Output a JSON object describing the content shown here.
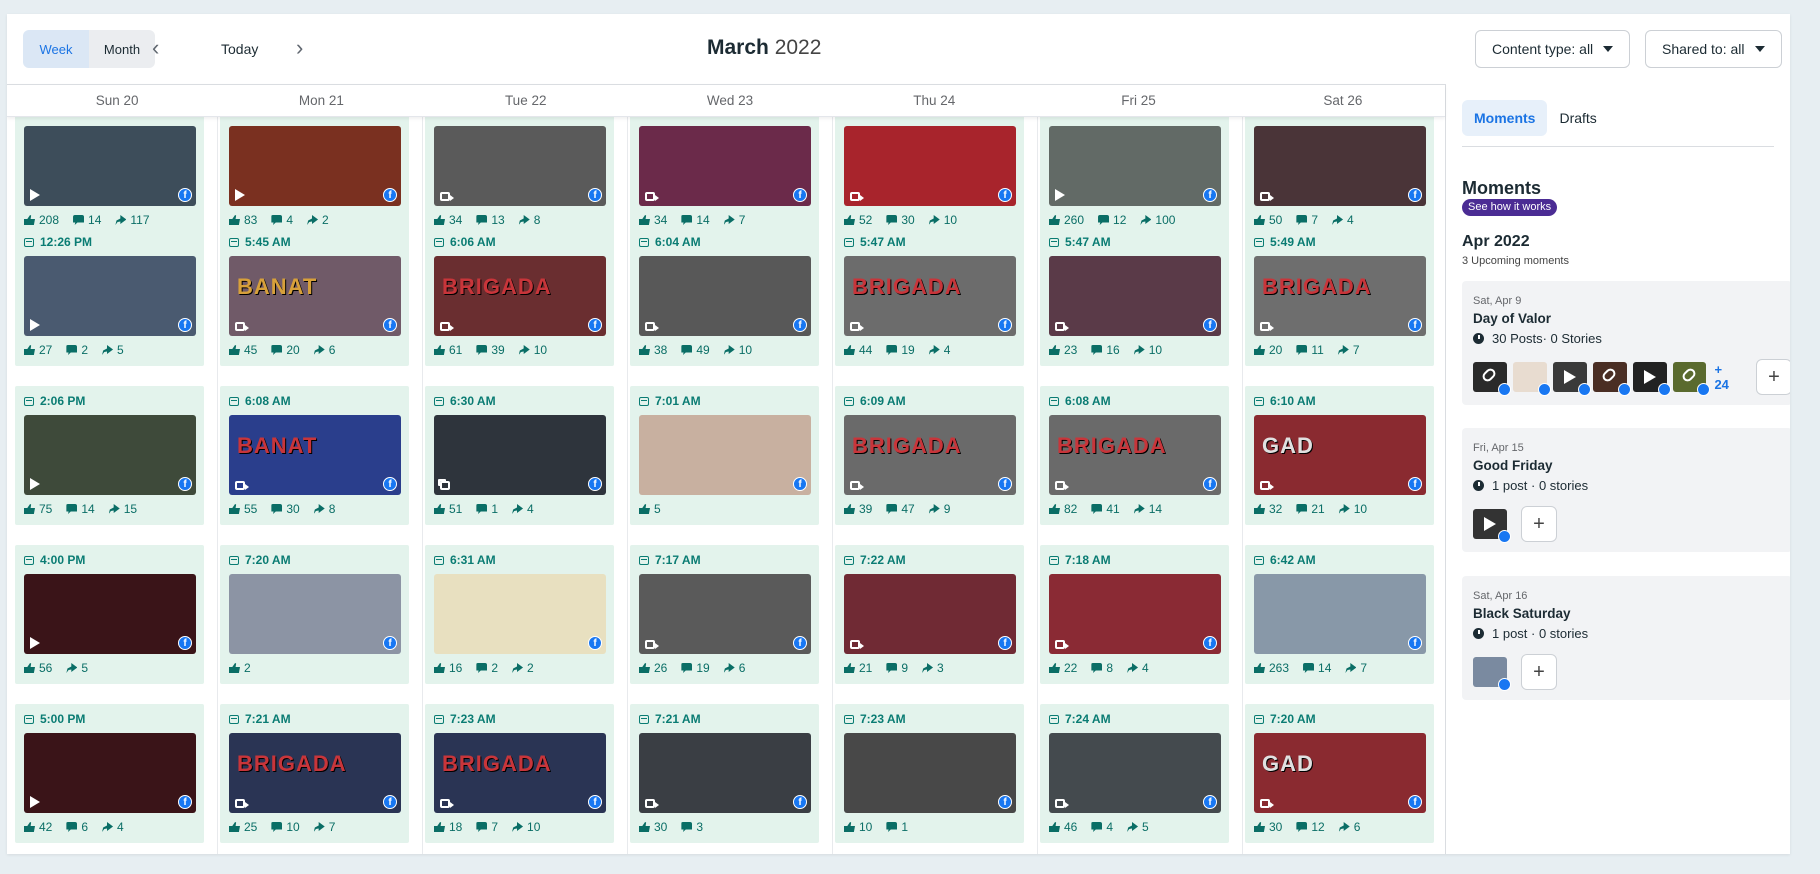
{
  "toolbar": {
    "week_label": "Week",
    "month_label": "Month",
    "today_label": "Today",
    "prev_icon": "‹",
    "next_icon": "›",
    "title_month": "March",
    "title_year": "2022",
    "content_type": "Content type: all",
    "shared_to": "Shared to: all"
  },
  "days": [
    "Sun 20",
    "Mon 21",
    "Tue 22",
    "Wed 23",
    "Thu 24",
    "Fri 25",
    "Sat 26"
  ],
  "rows": [
    [
      {
        "time": "",
        "type": "play",
        "bg": "#3d4d5a",
        "stats": {
          "likes": "208",
          "comments": "14",
          "shares": "117"
        }
      },
      {
        "time": "",
        "type": "play",
        "bg": "#7a3020",
        "stats": {
          "likes": "83",
          "comments": "4",
          "shares": "2"
        }
      },
      {
        "time": "",
        "type": "cam",
        "bg": "#5a5a5a",
        "stats": {
          "likes": "34",
          "comments": "13",
          "shares": "8"
        }
      },
      {
        "time": "",
        "type": "cam",
        "bg": "#6b2a4a",
        "stats": {
          "likes": "34",
          "comments": "14",
          "shares": "7"
        }
      },
      {
        "time": "",
        "type": "cam",
        "bg": "#a8242c",
        "stats": {
          "likes": "52",
          "comments": "30",
          "shares": "10"
        }
      },
      {
        "time": "",
        "type": "play",
        "bg": "#626a66",
        "stats": {
          "likes": "260",
          "comments": "12",
          "shares": "100"
        }
      },
      {
        "time": "",
        "type": "cam",
        "bg": "#4a3438",
        "stats": {
          "likes": "50",
          "comments": "7",
          "shares": "4"
        }
      }
    ],
    [
      {
        "time": "12:26 PM",
        "type": "play",
        "bg": "#4a5a70",
        "title": "",
        "tcolor": "#fff",
        "stats": {
          "likes": "27",
          "comments": "2",
          "shares": "5"
        }
      },
      {
        "time": "5:45 AM",
        "type": "cam",
        "bg": "#705a68",
        "title": "BANAT",
        "tcolor": "#d7a03a",
        "stats": {
          "likes": "45",
          "comments": "20",
          "shares": "6"
        }
      },
      {
        "time": "6:06 AM",
        "type": "cam",
        "bg": "#6a2e30",
        "title": "BRIGADA",
        "tcolor": "#c8353a",
        "stats": {
          "likes": "61",
          "comments": "39",
          "shares": "10"
        }
      },
      {
        "time": "6:04 AM",
        "type": "cam",
        "bg": "#585858",
        "title": "",
        "tcolor": "#c22",
        "stats": {
          "likes": "38",
          "comments": "49",
          "shares": "10"
        }
      },
      {
        "time": "5:47 AM",
        "type": "cam",
        "bg": "#6c6c6c",
        "title": "BRIGADA",
        "tcolor": "#c8353a",
        "stats": {
          "likes": "44",
          "comments": "19",
          "shares": "4"
        }
      },
      {
        "time": "5:47 AM",
        "type": "cam",
        "bg": "#5a3a48",
        "title": "",
        "tcolor": "#fff",
        "stats": {
          "likes": "23",
          "comments": "16",
          "shares": "10"
        }
      },
      {
        "time": "5:49 AM",
        "type": "cam",
        "bg": "#6e6e6e",
        "title": "BRIGADA",
        "tcolor": "#c8353a",
        "stats": {
          "likes": "20",
          "comments": "11",
          "shares": "7"
        }
      }
    ],
    [
      {
        "time": "2:06 PM",
        "type": "play",
        "bg": "#3e4a3a",
        "title": "",
        "tcolor": "#fff",
        "stats": {
          "likes": "75",
          "comments": "14",
          "shares": "15"
        }
      },
      {
        "time": "6:08 AM",
        "type": "cam",
        "bg": "#2a3e8c",
        "title": "BANAT",
        "tcolor": "#c8353a",
        "stats": {
          "likes": "55",
          "comments": "30",
          "shares": "8"
        }
      },
      {
        "time": "6:30 AM",
        "type": "album",
        "bg": "#2e343c",
        "title": "",
        "tcolor": "#fff",
        "stats": {
          "likes": "51",
          "comments": "1",
          "shares": "4"
        }
      },
      {
        "time": "7:01 AM",
        "type": "none",
        "bg": "#c8b0a0",
        "title": "",
        "tcolor": "#fff",
        "stats": {
          "likes": "5",
          "comments": "",
          "shares": ""
        }
      },
      {
        "time": "6:09 AM",
        "type": "cam",
        "bg": "#6a6a6a",
        "title": "BRIGADA",
        "tcolor": "#c8353a",
        "stats": {
          "likes": "39",
          "comments": "47",
          "shares": "9"
        }
      },
      {
        "time": "6:08 AM",
        "type": "cam",
        "bg": "#6a6a6a",
        "title": "BRIGADA",
        "tcolor": "#c8353a",
        "stats": {
          "likes": "82",
          "comments": "41",
          "shares": "14"
        }
      },
      {
        "time": "6:10 AM",
        "type": "cam",
        "bg": "#8a2a30",
        "title": "GAD",
        "tcolor": "#e0e0e0",
        "stats": {
          "likes": "32",
          "comments": "21",
          "shares": "10"
        }
      }
    ],
    [
      {
        "time": "4:00 PM",
        "type": "play",
        "bg": "#3a1418",
        "title": "",
        "tcolor": "#fff",
        "stats": {
          "likes": "56",
          "comments": "",
          "shares": "5"
        }
      },
      {
        "time": "7:20 AM",
        "type": "none",
        "bg": "#8c94a4",
        "title": "",
        "tcolor": "#fff",
        "stats": {
          "likes": "2",
          "comments": "",
          "shares": ""
        }
      },
      {
        "time": "6:31 AM",
        "type": "none",
        "bg": "#e8e0c0",
        "title": "",
        "tcolor": "#333",
        "stats": {
          "likes": "16",
          "comments": "2",
          "shares": "2"
        }
      },
      {
        "time": "7:17 AM",
        "type": "cam",
        "bg": "#5a5a5a",
        "title": "",
        "tcolor": "#c22",
        "stats": {
          "likes": "26",
          "comments": "19",
          "shares": "6"
        }
      },
      {
        "time": "7:22 AM",
        "type": "cam",
        "bg": "#702a34",
        "title": "",
        "tcolor": "#fff",
        "stats": {
          "likes": "21",
          "comments": "9",
          "shares": "3"
        }
      },
      {
        "time": "7:18 AM",
        "type": "cam",
        "bg": "#8a2a34",
        "title": "",
        "tcolor": "#fff",
        "stats": {
          "likes": "22",
          "comments": "8",
          "shares": "4"
        }
      },
      {
        "time": "6:42 AM",
        "type": "none",
        "bg": "#8898a8",
        "title": "",
        "tcolor": "#fff",
        "stats": {
          "likes": "263",
          "comments": "14",
          "shares": "7"
        }
      }
    ],
    [
      {
        "time": "5:00 PM",
        "type": "play",
        "bg": "#3a1418",
        "title": "",
        "tcolor": "#fff",
        "stats": {
          "likes": "42",
          "comments": "6",
          "shares": "4"
        }
      },
      {
        "time": "7:21 AM",
        "type": "cam",
        "bg": "#2a3454",
        "title": "BRIGADA",
        "tcolor": "#c8353a",
        "stats": {
          "likes": "25",
          "comments": "10",
          "shares": "7"
        }
      },
      {
        "time": "7:23 AM",
        "type": "cam",
        "bg": "#2a3454",
        "title": "BRIGADA",
        "tcolor": "#c8353a",
        "stats": {
          "likes": "18",
          "comments": "7",
          "shares": "10"
        }
      },
      {
        "time": "7:21 AM",
        "type": "cam",
        "bg": "#3a3e44",
        "title": "",
        "tcolor": "#fff",
        "stats": {
          "likes": "30",
          "comments": "3",
          "shares": ""
        }
      },
      {
        "time": "7:23 AM",
        "type": "none",
        "bg": "#484848",
        "title": "",
        "tcolor": "#fff",
        "stats": {
          "likes": "10",
          "comments": "1",
          "shares": ""
        }
      },
      {
        "time": "7:24 AM",
        "type": "cam",
        "bg": "#444a4e",
        "title": "",
        "tcolor": "#fff",
        "stats": {
          "likes": "46",
          "comments": "4",
          "shares": "5"
        }
      },
      {
        "time": "7:20 AM",
        "type": "cam",
        "bg": "#8a2a30",
        "title": "GAD",
        "tcolor": "#e0e0e0",
        "stats": {
          "likes": "30",
          "comments": "12",
          "shares": "6"
        }
      }
    ]
  ],
  "sidebar": {
    "tab_moments": "Moments",
    "tab_drafts": "Drafts",
    "title": "Moments",
    "how_link": "See how it works",
    "month": "Apr 2022",
    "upcoming": "3 Upcoming moments",
    "moments": [
      {
        "date": "Sat, Apr 9",
        "name": "Day of Valor",
        "posts": "30 Posts· 0 Stories",
        "more": "+ 24"
      },
      {
        "date": "Fri, Apr 15",
        "name": "Good Friday",
        "posts": "1 post · 0 stories",
        "more": ""
      },
      {
        "date": "Sat, Apr 16",
        "name": "Black Saturday",
        "posts": "1 post · 0 stories",
        "more": ""
      }
    ],
    "add_label": "+"
  },
  "icons": {
    "badge": "facebook-icon",
    "like": "like-icon",
    "comment": "comment-icon",
    "share": "share-icon"
  },
  "colors": {
    "accent": "#1b74e4",
    "card_bg": "#e3f3ec",
    "stat_text": "#0a6e66",
    "badge_purple": "#4b2c94"
  }
}
